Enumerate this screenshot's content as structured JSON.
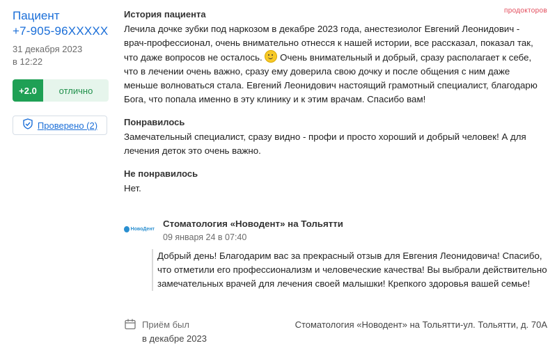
{
  "brand": {
    "name": "продокторов"
  },
  "author": {
    "name": "Пациент",
    "phone": "+7-905-96XXXXX",
    "date": "31 декабря 2023",
    "time": "в 12:22"
  },
  "rating": {
    "score": "+2.0",
    "label": "отлично"
  },
  "verified": {
    "label": "Проверено (2)"
  },
  "review": {
    "history_title": "История пациента",
    "history_text_1": "Лечила дочке зубки под наркозом в декабре 2023 года, анестезиолог Евгений Леонидович - врач-профессионал, очень внимательно отнесся к нашей истории, все рассказал, показал так, что даже вопросов не осталось.",
    "history_text_2": "Очень внимательный и добрый, сразу располагает к себе, что в лечении очень важно, сразу ему доверила свою дочку и после общения с ним даже меньше волноваться стала. Евгений Леонидович настоящий грамотный специалист, благодарю Бога, что попала именно в эту клинику и к этим врачам. Спасибо вам!",
    "liked_title": "Понравилось",
    "liked_text": "Замечательный специалист, сразу видно - профи и просто хороший и добрый человек! А для лечения деток это очень важно.",
    "disliked_title": "Не понравилось",
    "disliked_text": "Нет."
  },
  "clinic_reply": {
    "logo_text": "НовоДент",
    "name": "Стоматология «Новодент» на Тольятти",
    "date": "09 января 24 в 07:40",
    "text": "Добрый день! Благодарим вас за прекрасный отзыв для Евгения Леонидовича! Спасибо, что отметили его профессионализм и человеческие качества! Вы выбрали действительно замечательных врачей для лечения своей малышки! Крепкого здоровья вашей семье!"
  },
  "visit": {
    "label": "Приём был",
    "when": "в декабре 2023",
    "address": "Стоматология «Новодент» на Тольятти-ул. Тольятти, д. 70А"
  }
}
